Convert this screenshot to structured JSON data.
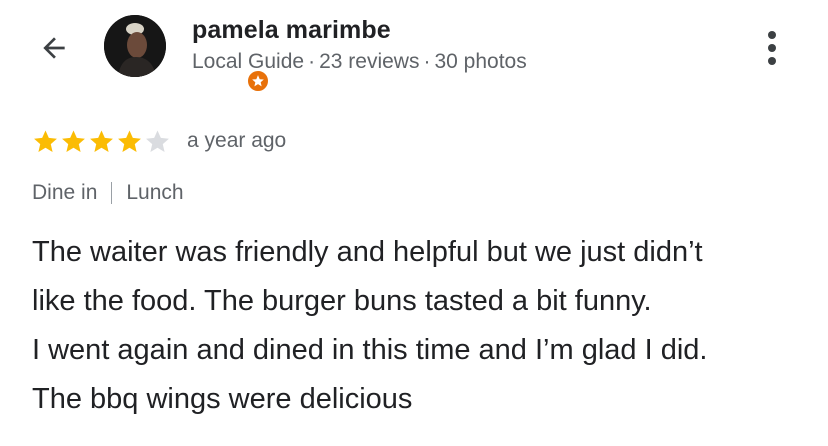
{
  "header": {
    "back_icon": "arrow-left-icon",
    "avatar_icon": "avatar-photo",
    "badge_icon": "local-guide-star-badge-icon",
    "author_name": "pamela marimbe",
    "meta": {
      "role": "Local Guide",
      "reviews": "23 reviews",
      "photos": "30 photos",
      "separator": "·"
    },
    "more_icon": "more-vertical-icon"
  },
  "review": {
    "rating": 4,
    "max_rating": 5,
    "time_ago": "a year ago",
    "tags": [
      "Dine in",
      "Lunch"
    ],
    "text_lines": [
      "The waiter was friendly and helpful but we just didn’t",
      "like the food. The burger buns tasted a bit funny.",
      "I went again and dined in this time and I’m glad I did.",
      "The bbq wings were delicious"
    ]
  },
  "colors": {
    "star_filled": "#fbbc04",
    "star_empty": "#dadce0",
    "badge": "#e8710a",
    "primary_text": "#202124",
    "secondary_text": "#5f6368"
  }
}
